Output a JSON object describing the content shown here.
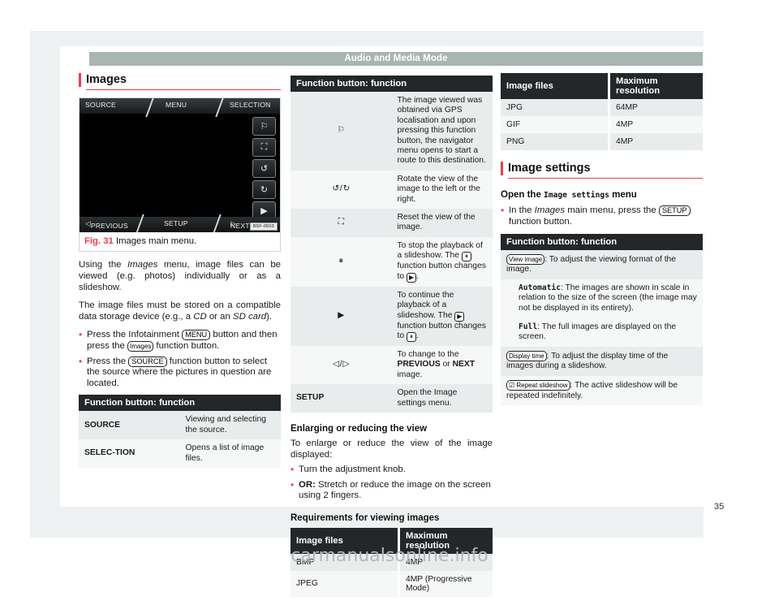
{
  "header": {
    "title": "Audio and Media Mode"
  },
  "page_number": "35",
  "watermark": "carmanualsonline.info",
  "left": {
    "section_title": "Images",
    "figure": {
      "top_buttons": [
        "SOURCE",
        "MENU",
        "SELECTION"
      ],
      "bottom_buttons": [
        "PREVIOUS",
        "SETUP",
        "NEXT"
      ],
      "side_buttons": [
        "flag-icon",
        "reset-view-icon",
        "rotate-left-icon",
        "rotate-right-icon",
        "play-icon"
      ],
      "code_label": "B5F-0503",
      "caption_number": "Fig. 31",
      "caption_text": "Images main menu."
    },
    "paragraph_1_a": "Using the ",
    "paragraph_1_i": "Images",
    "paragraph_1_b": " menu, image files can be viewed (e.g. photos) individually or as a slideshow.",
    "paragraph_2_a": "The image files must be stored on a compatible data storage device (e.g., a ",
    "paragraph_2_i1": "CD",
    "paragraph_2_b": " or an ",
    "paragraph_2_i2": "SD card",
    "paragraph_2_c": ").",
    "bullet_1_a": "Press the Infotainment ",
    "bullet_1_key1": "MENU",
    "bullet_1_b": " button and then press the ",
    "bullet_1_key2": "Images",
    "bullet_1_c": " function button.",
    "bullet_2_a": "Press the ",
    "bullet_2_key": "SOURCE",
    "bullet_2_b": " function button to select the source where the pictures in question are located.",
    "table": {
      "header": "Function button: function",
      "rows": [
        {
          "key": "SOURCE",
          "desc": "Viewing and selecting the source."
        },
        {
          "key": "SELEC-TION",
          "desc": "Opens a list of image files."
        }
      ]
    }
  },
  "middle": {
    "table": {
      "header": "Function button: function",
      "rows": [
        {
          "icon": "flag-icon",
          "desc": "The image viewed was obtained via GPS localisation and upon pressing this function button, the navigator menu opens to start a route to this destination."
        },
        {
          "icon": "rotate-left-right-icon",
          "desc": "Rotate the view of the image to the left or the right."
        },
        {
          "icon": "reset-view-icon",
          "desc": "Reset the view of the image."
        },
        {
          "icon": "pause-icon",
          "desc_a": "To stop the playback of a slideshow. The ",
          "desc_key": "pause",
          "desc_b": " function button changes to ",
          "desc_key2": "play",
          "desc_c": "."
        },
        {
          "icon": "play-icon",
          "desc_a": "To continue the playback of a slideshow. The ",
          "desc_key": "play",
          "desc_b": " function button changes to ",
          "desc_key2": "pause",
          "desc_c": "."
        },
        {
          "icon": "prev-next-icon",
          "desc_a": "To change to the ",
          "desc_b1": "PREVIOUS",
          "desc_mid": " or ",
          "desc_b2": "NEXT",
          "desc_c": " image."
        },
        {
          "key": "SETUP",
          "desc": "Open the Image settings menu."
        }
      ]
    },
    "heading_enlarge": "Enlarging or reducing the view",
    "paragraph_enlarge": "To enlarge or reduce the view of the image displayed:",
    "bullet_1": "Turn the adjustment knob.",
    "bullet_2_b": "OR:",
    "bullet_2_t": " Stretch or reduce the image on the screen using 2 fingers.",
    "heading_requirements": "Requirements for viewing images",
    "res_table": {
      "col1": "Image files",
      "col2": "Maximum resolution",
      "rows": [
        {
          "file": "BMP",
          "res": "4MP"
        },
        {
          "file": "JPEG",
          "res": "4MP (Progressive Mode)"
        }
      ]
    }
  },
  "right": {
    "res_table": {
      "col1": "Image files",
      "col2": "Maximum resolution",
      "rows": [
        {
          "file": "JPG",
          "res": "64MP"
        },
        {
          "file": "GIF",
          "res": "4MP"
        },
        {
          "file": "PNG",
          "res": "4MP"
        }
      ]
    },
    "section_title": "Image settings",
    "heading_open_a": "Open the ",
    "heading_open_mono": "Image settings",
    "heading_open_b": " menu",
    "bullet_1_a": "In the ",
    "bullet_1_i": "Images",
    "bullet_1_b": " main menu, press the ",
    "bullet_1_key": "SETUP",
    "bullet_1_c": " function button.",
    "table": {
      "header": "Function button: function",
      "rows": [
        {
          "key": "View image",
          "desc": ": To adjust the viewing format of the image."
        },
        {
          "sub_key": "Automatic",
          "desc": ": The images are shown in scale in relation to the size of the screen (the image may not be displayed in its entirety)."
        },
        {
          "sub_key": "Full",
          "desc": ": The full images are displayed on the screen."
        },
        {
          "key": "Display time",
          "desc": ": To adjust the display time of the images during a slideshow."
        },
        {
          "key": "☑ Repeat slideshow",
          "desc": ": The active slideshow will be repeated indefinitely."
        }
      ]
    }
  }
}
